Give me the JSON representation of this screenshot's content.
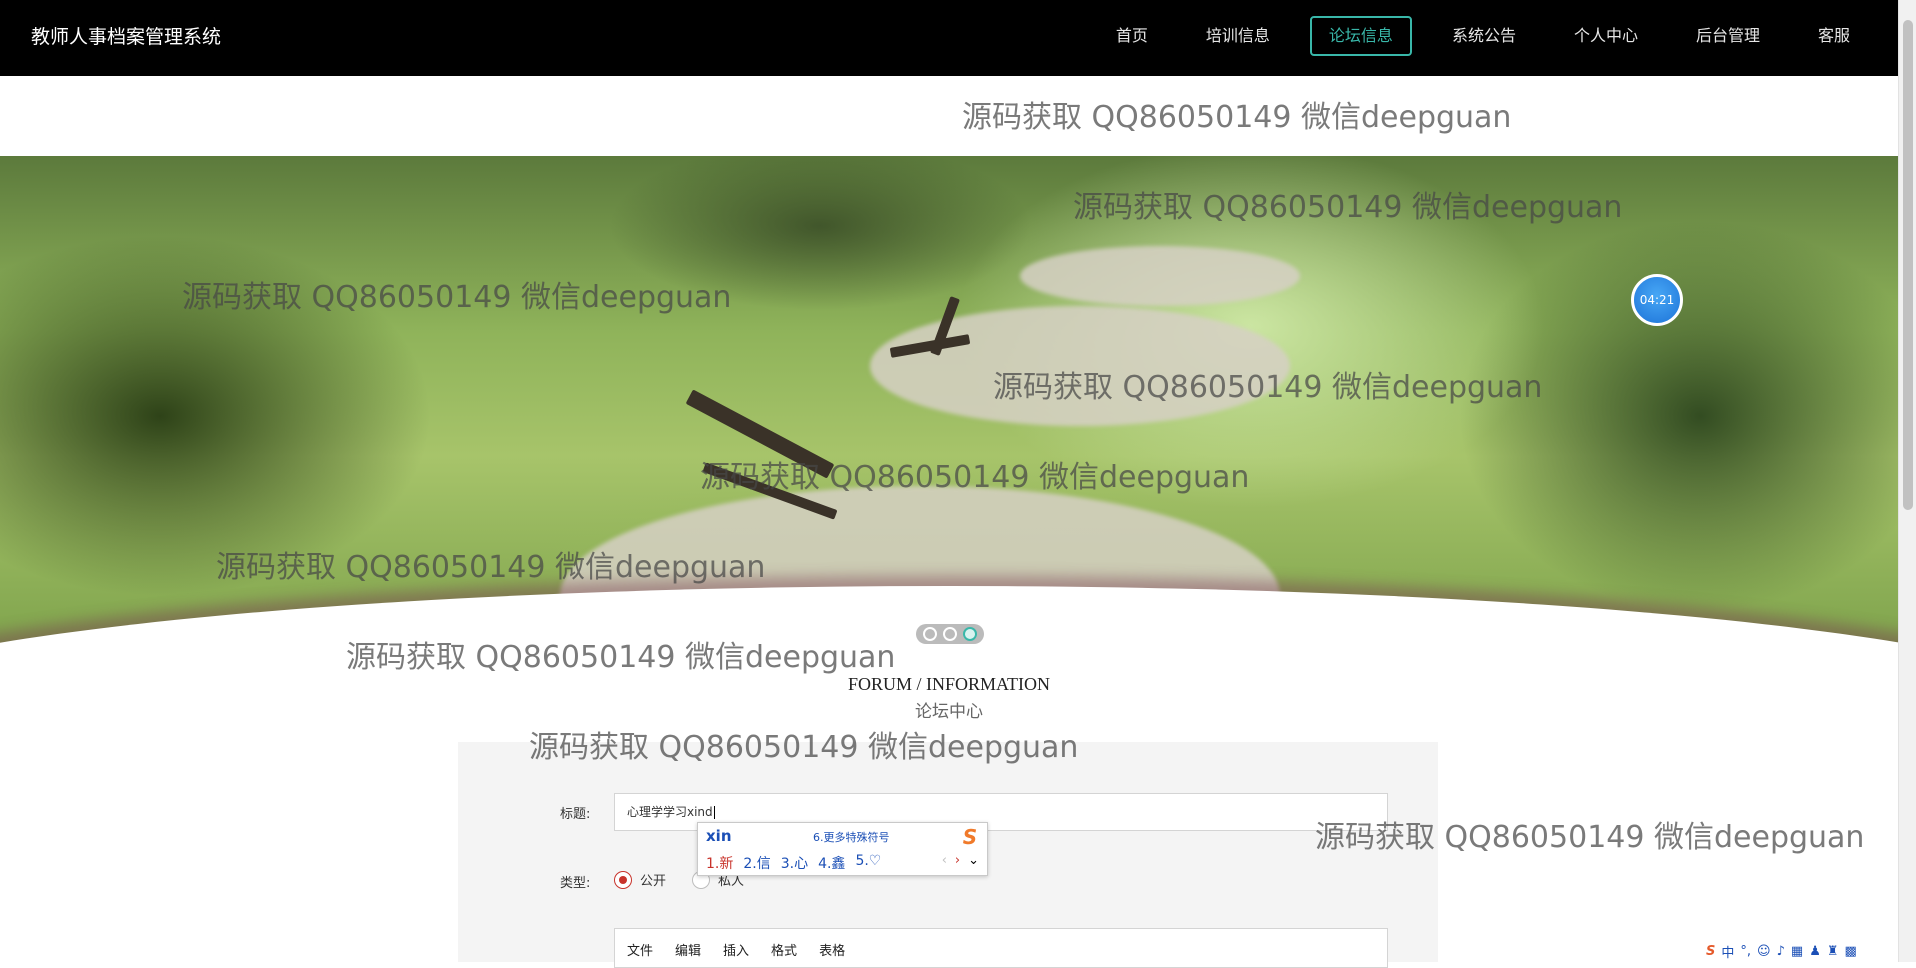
{
  "app": {
    "title": "教师人事档案管理系统"
  },
  "nav": {
    "items": [
      {
        "label": "首页"
      },
      {
        "label": "培训信息"
      },
      {
        "label": "论坛信息",
        "active": true
      },
      {
        "label": "系统公告"
      },
      {
        "label": "个人中心"
      },
      {
        "label": "后台管理"
      },
      {
        "label": "客服"
      }
    ]
  },
  "banner": {
    "timer": "04:21",
    "slide_count": 3,
    "active_slide": 3
  },
  "section": {
    "title_en": "FORUM / INFORMATION",
    "title_cn": "论坛中心"
  },
  "form": {
    "title_label": "标题:",
    "title_value": "心理学学习xind",
    "type_label": "类型:",
    "type_options": [
      {
        "label": "公开",
        "checked": true
      },
      {
        "label": "私人",
        "checked": false
      }
    ],
    "editor_menu": [
      "文件",
      "编辑",
      "插入",
      "格式",
      "表格"
    ]
  },
  "ime": {
    "pinyin": "xin",
    "more": "6.更多特殊符号",
    "candidates": [
      "1.新",
      "2.信",
      "3.心",
      "4.鑫",
      "5.♡"
    ]
  },
  "watermark": {
    "text": "源码获取 QQ86050149 微信deepguan"
  },
  "tray": {
    "label": "中"
  },
  "colors": {
    "nav_bg": "#000000",
    "accent": "#39b7a9",
    "radio_checked": "#c8332b",
    "ime_text": "#1b4fb6"
  }
}
